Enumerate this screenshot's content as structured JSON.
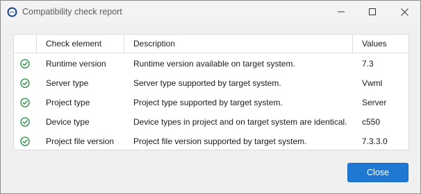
{
  "window": {
    "title": "Compatibility check report",
    "controls": [
      "minimize",
      "maximize",
      "close"
    ]
  },
  "table": {
    "columns": [
      "",
      "Check element",
      "Description",
      "Values"
    ],
    "rows": [
      {
        "status": "check-circle-icon",
        "element": "Runtime version",
        "description": "Runtime version available on target system.",
        "value": "7.3"
      },
      {
        "status": "check-circle-icon",
        "element": "Server type",
        "description": "Server type supported by target system.",
        "value": "Vwml"
      },
      {
        "status": "check-circle-icon",
        "element": "Project type",
        "description": "Project type supported by target system.",
        "value": "Server"
      },
      {
        "status": "check-circle-icon",
        "element": "Device type",
        "description": "Device types in project and on target system are identical.",
        "value": "c550"
      },
      {
        "status": "check-circle-icon",
        "element": "Project file version",
        "description": "Project file version supported by target system.",
        "value": "7.3.3.0"
      }
    ]
  },
  "footer": {
    "close_label": "Close"
  },
  "colors": {
    "accent": "#1f78d1",
    "success": "#1e8a3c"
  }
}
